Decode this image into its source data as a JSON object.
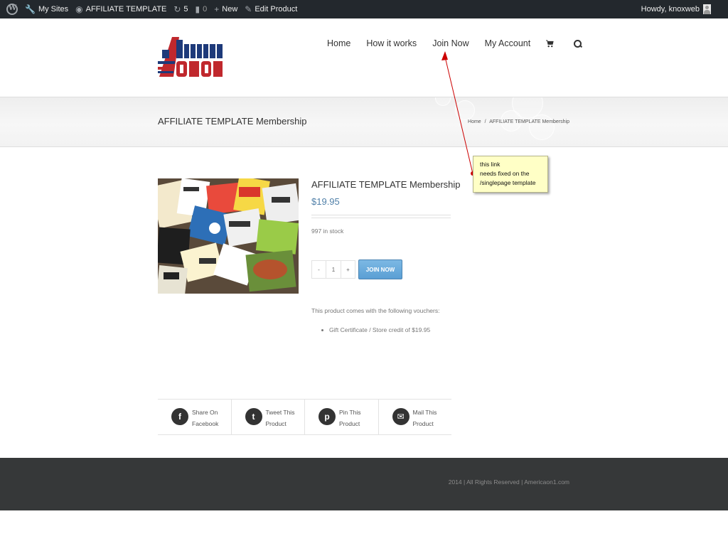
{
  "admin_bar": {
    "items": [
      {
        "label": "",
        "icon": "wordpress-icon"
      },
      {
        "label": "My Sites",
        "icon": "wrench-icon"
      },
      {
        "label": "AFFILIATE TEMPLATE",
        "icon": "dashboard-icon"
      },
      {
        "label": "5",
        "icon": "updates-icon"
      },
      {
        "label": "0",
        "icon": "comment-icon"
      },
      {
        "label": "New",
        "icon": "plus-icon"
      },
      {
        "label": "Edit Product",
        "icon": "pencil-icon"
      }
    ],
    "greeting": "Howdy, knoxweb"
  },
  "header": {
    "logo_text": "America on one",
    "nav": [
      "Home",
      "How it works",
      "Join Now",
      "My Account"
    ],
    "icons": [
      "cart-icon",
      "search-icon"
    ]
  },
  "title_bar": {
    "title": "AFFILIATE TEMPLATE Membership",
    "breadcrumb_home": "Home",
    "breadcrumb_sep": "/",
    "breadcrumb_current": "AFFILIATE TEMPLATE Membership"
  },
  "product": {
    "title": "AFFILIATE TEMPLATE Membership",
    "price": "$19.95",
    "stock": "997 in stock",
    "qty_minus": "-",
    "qty_value": "1",
    "qty_plus": "+",
    "button": "JOIN NOW",
    "description": "This product comes with the following vouchers:",
    "voucher": "Gift Certificate / Store credit of $19.95"
  },
  "share": [
    {
      "line1": "Share On",
      "line2": "Facebook",
      "icon": "facebook-icon",
      "glyph": "f"
    },
    {
      "line1": "Tweet This",
      "line2": "Product",
      "icon": "twitter-icon",
      "glyph": "t"
    },
    {
      "line1": "Pin This",
      "line2": "Product",
      "icon": "pinterest-icon",
      "glyph": "p"
    },
    {
      "line1": "Mail This",
      "line2": "Product",
      "icon": "mail-icon",
      "glyph": "✉"
    }
  ],
  "footer": {
    "copyright": "2014 | All Rights Reserved | Americaon1.com"
  },
  "annotation": {
    "lines": [
      "this link",
      "needs fixed on the",
      "/singlepage template"
    ]
  },
  "colors": {
    "admin_bar": "#23282d",
    "price": "#4f7fa8",
    "button": "#5a9fd4",
    "footer": "#363839",
    "note": "#ffffc6",
    "arrow": "#cc0000"
  }
}
